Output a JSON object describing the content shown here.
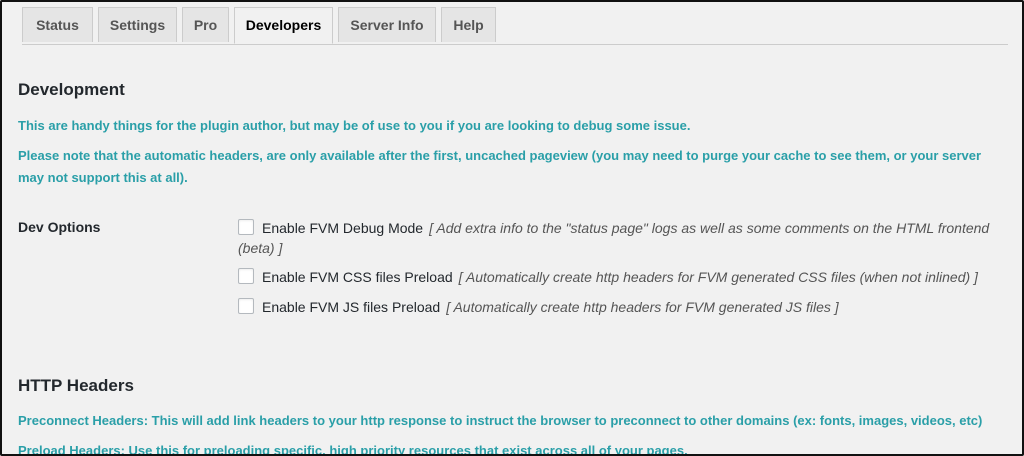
{
  "tabs": [
    {
      "label": "Status",
      "active": false
    },
    {
      "label": "Settings",
      "active": false
    },
    {
      "label": "Pro",
      "active": false
    },
    {
      "label": "Developers",
      "active": true
    },
    {
      "label": "Server Info",
      "active": false
    },
    {
      "label": "Help",
      "active": false
    }
  ],
  "development": {
    "title": "Development",
    "desc1": "This are handy things for the plugin author, but may be of use to you if you are looking to debug some issue.",
    "desc2": "Please note that the automatic headers, are only available after the first, uncached pageview (you may need to purge your cache to see them, or your server may not support this at all)."
  },
  "dev_options": {
    "label": "Dev Options",
    "items": [
      {
        "label": "Enable FVM Debug Mode",
        "hint": "[ Add extra info to the \"status page\" logs as well as some comments on the HTML frontend (beta) ]",
        "checked": false
      },
      {
        "label": "Enable FVM CSS files Preload",
        "hint": "[ Automatically create http headers for FVM generated CSS files (when not inlined) ]",
        "checked": false
      },
      {
        "label": "Enable FVM JS files Preload",
        "hint": "[ Automatically create http headers for FVM generated JS files ]",
        "checked": false
      }
    ]
  },
  "http_headers": {
    "title": "HTTP Headers",
    "desc1": "Preconnect Headers: This will add link headers to your http response to instruct the browser to preconnect to other domains (ex: fonts, images, videos, etc)",
    "desc2": "Preload Headers: Use this for preloading specific, high priority resources that exist across all of your pages."
  },
  "colors": {
    "accent_text": "#2a9fa8",
    "background": "#f1f1f1",
    "tab_inactive": "#e5e5e5"
  }
}
